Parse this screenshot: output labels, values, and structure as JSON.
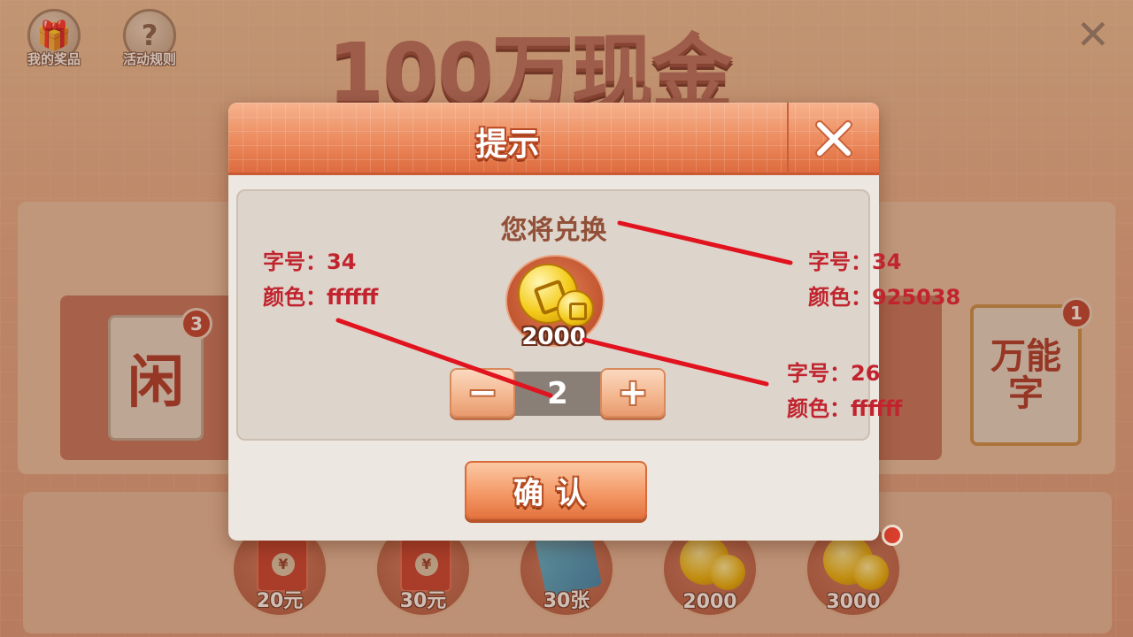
{
  "background": {
    "top_left_icons": [
      {
        "label": "我的奖品",
        "icon": "gift-icon"
      },
      {
        "label": "活动规则",
        "icon": "question-icon"
      }
    ],
    "event_title": "100万现金",
    "close_icon": "close-icon",
    "tiles": [
      {
        "char": "闲",
        "badge": "3"
      },
      {
        "char": "万能字",
        "badge": "1"
      }
    ],
    "rewards": [
      {
        "label": "20元",
        "icon": "red-envelope-icon"
      },
      {
        "label": "30元",
        "icon": "red-envelope-icon"
      },
      {
        "label": "30张",
        "icon": "ticket-icon"
      },
      {
        "label": "2000",
        "icon": "coin-icon"
      },
      {
        "label": "3000",
        "icon": "coin-icon"
      }
    ]
  },
  "dialog": {
    "title": "提示",
    "close_icon": "close-icon",
    "exchange_label": "您将兑换",
    "prize": {
      "icon": "coin-icon",
      "amount": "2000"
    },
    "stepper": {
      "minus": "−",
      "plus": "+",
      "quantity": "2"
    },
    "confirm_label": "确认"
  },
  "annotations": {
    "left": {
      "size_line": "字号：34",
      "color_line": "颜色：ffffff"
    },
    "right_top": {
      "size_line": "字号：34",
      "color_line": "颜色：925038"
    },
    "right_bottom": {
      "size_line": "字号：26",
      "color_line": "颜色：ffffff"
    },
    "line_color": "#e0131e"
  },
  "colors": {
    "title_brown": "#925038",
    "annotation_red": "#c1242e",
    "header_orange": "#ec8a5d"
  }
}
